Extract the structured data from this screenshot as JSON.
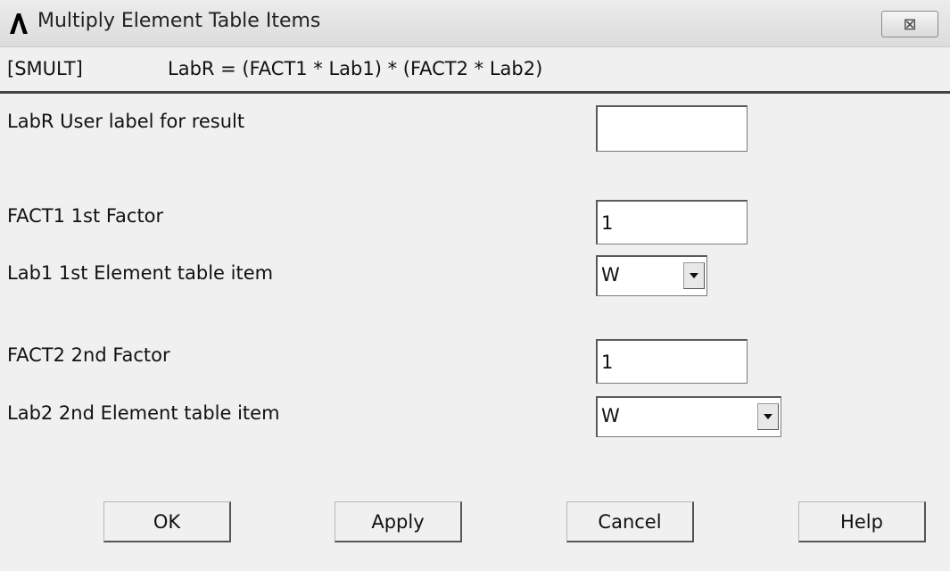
{
  "window": {
    "title": "Multiply Element Table Items",
    "close_symbol": "⊠",
    "icons": {
      "app": "ansys-logo-icon",
      "close": "close-icon"
    }
  },
  "command": {
    "tag": "[SMULT]",
    "formula": "LabR = (FACT1 * Lab1) * (FACT2 * Lab2)"
  },
  "fields": {
    "labr": {
      "label": "LabR   User label for result",
      "value": ""
    },
    "fact1": {
      "label": "FACT1  1st Factor",
      "value": "1"
    },
    "lab1": {
      "label": "Lab1   1st Element table item",
      "selected": "W"
    },
    "fact2": {
      "label": "FACT2  2nd Factor",
      "value": "1"
    },
    "lab2": {
      "label": "Lab2   2nd Element table item",
      "selected": "W"
    }
  },
  "buttons": {
    "ok": "OK",
    "apply": "Apply",
    "cancel": "Cancel",
    "help": "Help"
  }
}
